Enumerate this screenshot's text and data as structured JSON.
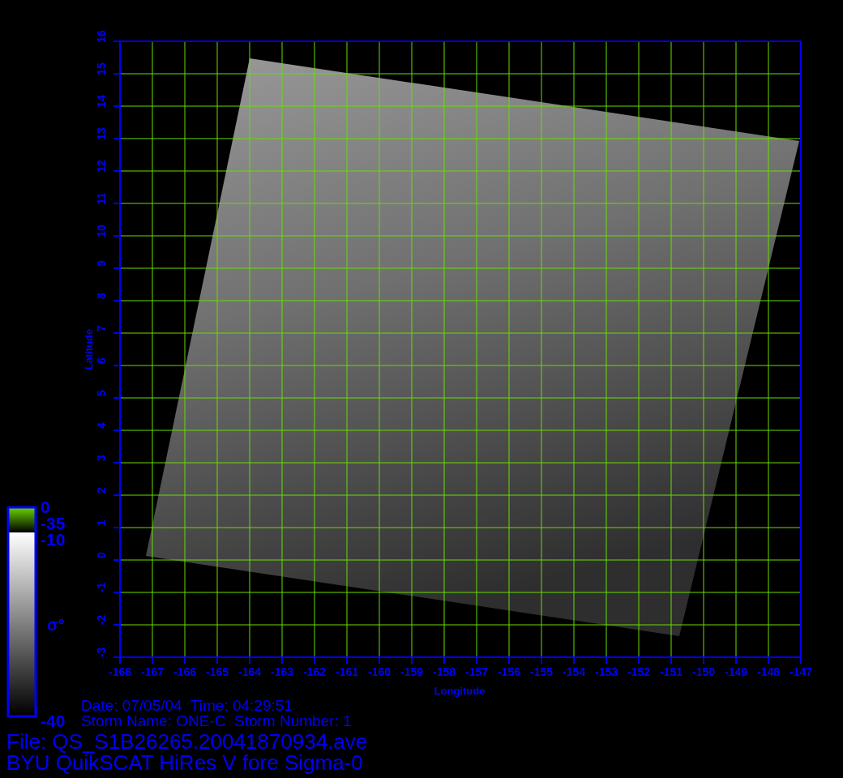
{
  "plot": {
    "latitude_label": "Latitude",
    "longitude_label": "Longitude",
    "latitude_ticks": [
      "-3",
      "-2",
      "-1",
      "0",
      "1",
      "2",
      "3",
      "4",
      "5",
      "6",
      "7",
      "8",
      "9",
      "10",
      "11",
      "12",
      "13",
      "14",
      "15",
      "16"
    ],
    "longitude_ticks": [
      "-168",
      "-167",
      "-166",
      "-165",
      "-164",
      "-163",
      "-162",
      "-161",
      "-160",
      "-159",
      "-158",
      "-157",
      "-156",
      "-155",
      "-154",
      "-153",
      "-152",
      "-151",
      "-150",
      "-149",
      "-148",
      "-147"
    ]
  },
  "colorbar": {
    "labels": [
      "0",
      "-35",
      "-10",
      "-40"
    ],
    "symbol": "σ°"
  },
  "info": {
    "date_line": "Date: 07/05/04  Time: 04:29:51",
    "storm_line": "Storm Name: ONE-C  Storm Number: 1"
  },
  "file_line": "File: QS_S1B26265.20041870934.ave",
  "title": "BYU QuikSCAT HiRes V fore Sigma-0"
}
